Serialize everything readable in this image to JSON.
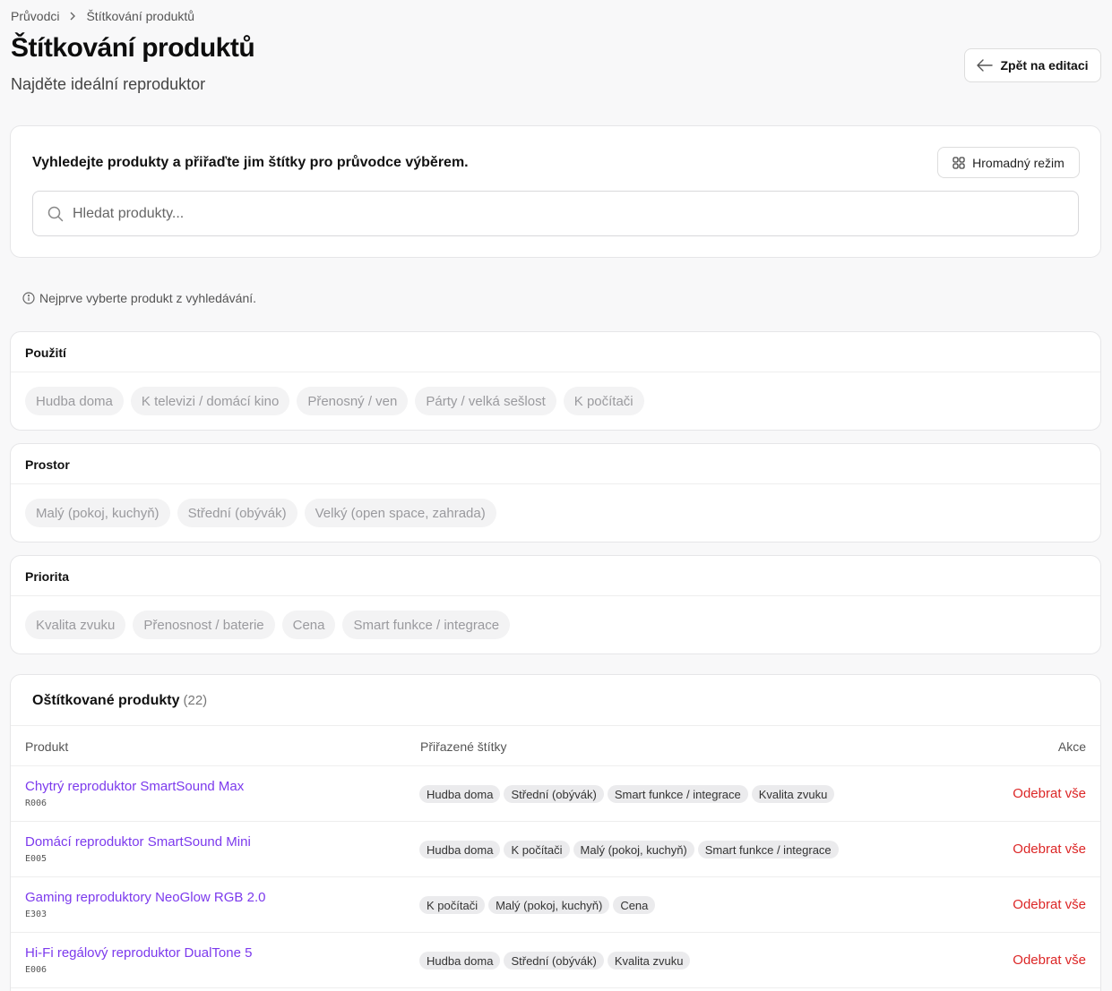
{
  "breadcrumb": {
    "parent": "Průvodci",
    "current": "Štítkování produktů"
  },
  "header": {
    "title": "Štítkování produktů",
    "subtitle": "Najděte ideální reproduktor",
    "back_label": "Zpět na editaci"
  },
  "search": {
    "heading": "Vyhledejte produkty a přiřaďte jim štítky pro průvodce výběrem.",
    "bulk_label": "Hromadný režim",
    "placeholder": "Hledat produkty..."
  },
  "hint": "Nejprve vyberte produkt z vyhledávání.",
  "categories": [
    {
      "title": "Použití",
      "tags": [
        "Hudba doma",
        "K televizi / domácí kino",
        "Přenosný / ven",
        "Párty / velká sešlost",
        "K počítači"
      ]
    },
    {
      "title": "Prostor",
      "tags": [
        "Malý (pokoj, kuchyň)",
        "Střední (obývák)",
        "Velký (open space, zahrada)"
      ]
    },
    {
      "title": "Priorita",
      "tags": [
        "Kvalita zvuku",
        "Přenosnost / baterie",
        "Cena",
        "Smart funkce / integrace"
      ]
    }
  ],
  "products": {
    "title": "Oštítkované produkty",
    "count": "(22)",
    "columns": {
      "product": "Produkt",
      "tags": "Přiřazené štítky",
      "actions": "Akce"
    },
    "remove_label": "Odebrat vše",
    "rows": [
      {
        "name": "Chytrý reproduktor SmartSound Max",
        "code": "R006",
        "tags": [
          "Hudba doma",
          "Střední (obývák)",
          "Smart funkce / integrace",
          "Kvalita zvuku"
        ]
      },
      {
        "name": "Domácí reproduktor SmartSound Mini",
        "code": "E005",
        "tags": [
          "Hudba doma",
          "K počítači",
          "Malý (pokoj, kuchyň)",
          "Smart funkce / integrace"
        ]
      },
      {
        "name": "Gaming reproduktory NeoGlow RGB 2.0",
        "code": "E303",
        "tags": [
          "K počítači",
          "Malý (pokoj, kuchyň)",
          "Cena"
        ]
      },
      {
        "name": "Hi-Fi regálový reproduktor DualTone 5",
        "code": "E006",
        "tags": [
          "Hudba doma",
          "Střední (obývák)",
          "Kvalita zvuku"
        ]
      }
    ]
  },
  "icons": {
    "breadcrumb_sep": "chevron-right-icon",
    "back": "arrow-left-icon",
    "bulk": "grid-icon",
    "search": "search-icon",
    "hint": "info-icon"
  },
  "colors": {
    "link": "#7c3aed",
    "danger": "#dc2626"
  }
}
